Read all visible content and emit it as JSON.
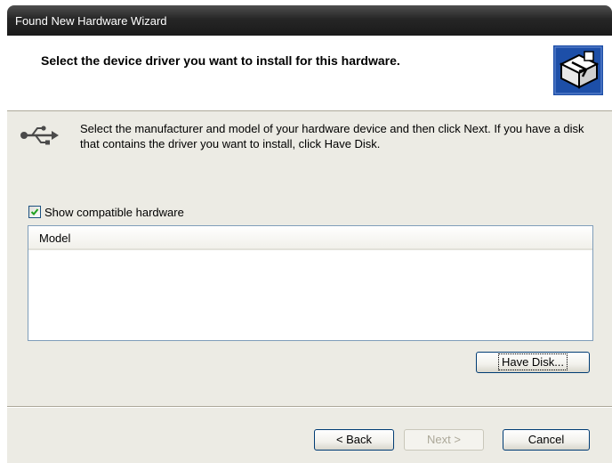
{
  "window": {
    "title": "Found New Hardware Wizard"
  },
  "header": {
    "title": "Select the device driver you want to install for this hardware.",
    "icon": "hardware-wizard-icon"
  },
  "instructions": {
    "icon": "usb-icon",
    "text": "Select the manufacturer and model of your hardware device and then click Next. If you have a disk that contains the driver you want to install, click Have Disk."
  },
  "checkbox": {
    "label": "Show compatible hardware",
    "checked": true
  },
  "model_list": {
    "column_header": "Model",
    "items": []
  },
  "buttons": {
    "have_disk": "Have Disk...",
    "back": "< Back",
    "next": "Next >",
    "cancel": "Cancel"
  },
  "colors": {
    "title_bar": "#262626",
    "dialog_bg": "#ecebe4",
    "list_border": "#7f9db9"
  }
}
